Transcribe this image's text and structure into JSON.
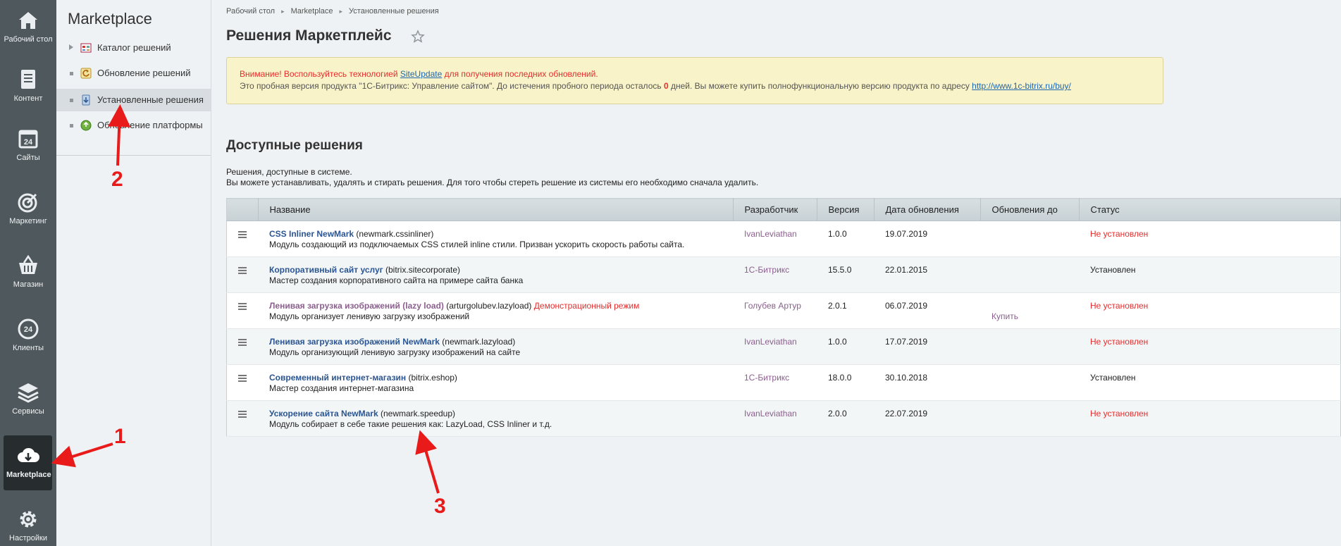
{
  "rail": {
    "items": [
      {
        "label": "Рабочий стол",
        "icon": "home-icon"
      },
      {
        "label": "Контент",
        "icon": "document-icon"
      },
      {
        "label": "Сайты",
        "icon": "calendar-24-icon"
      },
      {
        "label": "Маркетинг",
        "icon": "target-icon"
      },
      {
        "label": "Магазин",
        "icon": "basket-icon"
      },
      {
        "label": "Клиенты",
        "icon": "clients-24-icon"
      },
      {
        "label": "Сервисы",
        "icon": "layers-icon"
      },
      {
        "label": "Marketplace",
        "icon": "cloud-download-icon",
        "active": true
      },
      {
        "label": "Настройки",
        "icon": "gear-icon"
      }
    ]
  },
  "menu": {
    "title": "Marketplace",
    "items": [
      {
        "label": "Каталог решений",
        "expandable": true
      },
      {
        "label": "Обновление решений",
        "expandable": false
      },
      {
        "label": "Установленные решения",
        "expandable": false,
        "active": true
      },
      {
        "label": "Обновление платформы",
        "expandable": false
      }
    ]
  },
  "breadcrumb": [
    "Рабочий стол",
    "Marketplace",
    "Установленные решения"
  ],
  "page_title": "Решения Маркетплейс",
  "notice": {
    "warn_prefix": "Внимание! Воспользуйтесь технологией ",
    "warn_link": "SiteUpdate",
    "warn_suffix": " для получения последних обновлений.",
    "trial_prefix": "Это пробная версия продукта \"1С-Битрикс: Управление сайтом\". До истечения пробного периода осталось ",
    "trial_days": "0",
    "trial_suffix": " дней. Вы можете купить полнофункциональную версию продукта по адресу ",
    "trial_link": "http://www.1c-bitrix.ru/buy/"
  },
  "section": {
    "title": "Доступные решения",
    "desc1": "Решения, доступные в системе.",
    "desc2": "Вы можете устанавливать, удалять и стирать решения. Для того чтобы стереть решение из системы его необходимо сначала удалить."
  },
  "table": {
    "headers": [
      "Название",
      "Разработчик",
      "Версия",
      "Дата обновления",
      "Обновления до",
      "Статус"
    ],
    "rows": [
      {
        "name": "CSS Inliner NewMark",
        "code": " (newmark.cssinliner)",
        "demo": "",
        "desc": "Модуль создающий из подключаемых CSS стилей inline стили. Призван ускорить скорость работы сайта.",
        "developer": "IvanLeviathan",
        "version": "1.0.0",
        "date": "19.07.2019",
        "updates": "",
        "status": "Не установлен",
        "installed": false
      },
      {
        "name": "Корпоративный сайт услуг",
        "code": " (bitrix.sitecorporate)",
        "demo": "",
        "desc": "Мастер создания корпоративного сайта на примере сайта банка",
        "developer": "1С-Битрикс",
        "version": "15.5.0",
        "date": "22.01.2015",
        "updates": "",
        "status": "Установлен",
        "installed": true
      },
      {
        "name": "Ленивая загрузка изображений (lazy load)",
        "code": " (arturgolubev.lazyload) ",
        "demo": "Демонстрационный режим",
        "desc": "Модуль организует ленивую загрузку изображений",
        "developer": "Голубев Артур",
        "version": "2.0.1",
        "date": "06.07.2019",
        "updates": "Купить",
        "status": "Не установлен",
        "installed": false
      },
      {
        "name": "Ленивая загрузка изображений NewMark",
        "code": " (newmark.lazyload)",
        "demo": "",
        "desc": "Модуль организующий ленивую загрузку изображений на сайте",
        "developer": "IvanLeviathan",
        "version": "1.0.0",
        "date": "17.07.2019",
        "updates": "",
        "status": "Не установлен",
        "installed": false
      },
      {
        "name": "Современный интернет-магазин",
        "code": " (bitrix.eshop)",
        "demo": "",
        "desc": "Мастер создания интернет-магазина",
        "developer": "1С-Битрикс",
        "version": "18.0.0",
        "date": "30.10.2018",
        "updates": "",
        "status": "Установлен",
        "installed": true
      },
      {
        "name": "Ускорение сайта NewMark",
        "code": " (newmark.speedup)",
        "demo": "",
        "desc": "Модуль собирает в себе такие решения как: LazyLoad, CSS Inliner и т.д.",
        "developer": "IvanLeviathan",
        "version": "2.0.0",
        "date": "22.07.2019",
        "updates": "",
        "status": "Не установлен",
        "installed": false
      }
    ]
  },
  "annotations": [
    "1",
    "2",
    "3"
  ],
  "colors": {
    "rail_bg": "#4f585d",
    "rail_active": "#272c2f",
    "link": "#2b5592",
    "status_red": "#e52d2d",
    "arrow_red": "#e81a1a"
  }
}
